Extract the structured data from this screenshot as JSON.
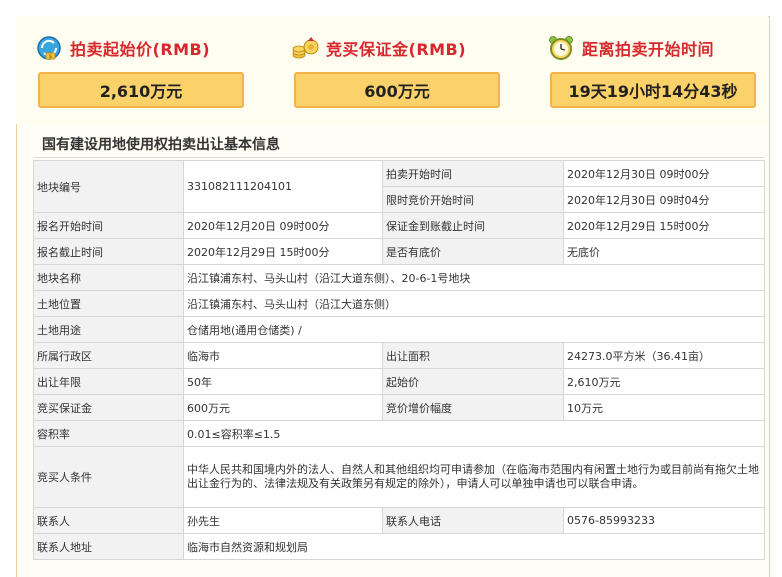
{
  "colors": {
    "accent_red": "#d7282d",
    "value_box_fill": "#fbd16a",
    "value_box_border": "#f2b24a",
    "label_cell_bg": "#f2f2f2"
  },
  "summary": {
    "start_price": {
      "icon": "money-icon",
      "title": "拍卖起始价(RMB)",
      "value": "2,610万元"
    },
    "deposit": {
      "icon": "coins-icon",
      "title": "竞买保证金(RMB)",
      "value": "600万元"
    },
    "countdown": {
      "icon": "alarm-clock-icon",
      "title": "距离拍卖开始时间",
      "value": "19天19小时14分43秒"
    }
  },
  "section_title": "国有建设用地使用权拍卖出让基本信息",
  "info": {
    "parcel_no_label": "地块编号",
    "parcel_no": "331082111204101",
    "auction_start_label": "拍卖开始时间",
    "auction_start": "2020年12月30日 09时00分",
    "timed_bid_start_label": "限时竞价开始时间",
    "timed_bid_start": "2020年12月30日 09时04分",
    "reg_start_label": "报名开始时间",
    "reg_start": "2020年12月20日 09时00分",
    "deposit_deadline_label": "保证金到账截止时间",
    "deposit_deadline": "2020年12月29日 15时00分",
    "reg_end_label": "报名截止时间",
    "reg_end": "2020年12月29日 15时00分",
    "reserve_label": "是否有底价",
    "reserve": "无底价",
    "parcel_name_label": "地块名称",
    "parcel_name": "沿江镇浦东村、马头山村（沿江大道东侧）、20-6-1号地块",
    "location_label": "土地位置",
    "location": "沿江镇浦东村、马头山村（沿江大道东侧）",
    "use_label": "土地用途",
    "use": "仓储用地(通用仓储类) /",
    "district_label": "所属行政区",
    "district": "临海市",
    "area_label": "出让面积",
    "area": "24273.0平方米（36.41亩）",
    "term_label": "出让年限",
    "term": "50年",
    "start_price_label": "起始价",
    "start_price": "2,610万元",
    "deposit_label": "竞买保证金",
    "deposit": "600万元",
    "increment_label": "竞价增价幅度",
    "increment": "10万元",
    "far_label": "容积率",
    "far": "0.01≤容积率≤1.5",
    "bidder_cond_label": "竞买人条件",
    "bidder_cond": "中华人民共和国境内外的法人、自然人和其他组织均可申请参加（在临海市范围内有闲置土地行为或目前尚有拖欠土地出让金行为的、法律法规及有关政策另有规定的除外），申请人可以单独申请也可以联合申请。",
    "contact_label": "联系人",
    "contact": "孙先生",
    "phone_label": "联系人电话",
    "phone": "0576-85993233",
    "address_label": "联系人地址",
    "address": "临海市自然资源和规划局"
  }
}
